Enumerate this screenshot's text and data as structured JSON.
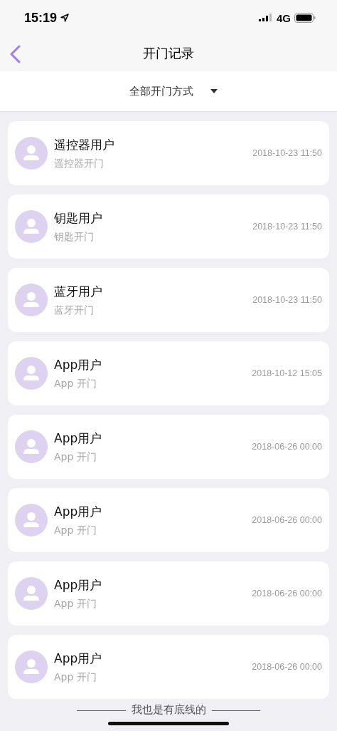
{
  "status_bar": {
    "time": "15:19",
    "network": "4G"
  },
  "nav": {
    "title": "开门记录"
  },
  "filter": {
    "label": "全部开门方式"
  },
  "records": [
    {
      "name": "遥控器用户",
      "method": "遥控器开门",
      "time": "2018-10-23 11:50"
    },
    {
      "name": "钥匙用户",
      "method": "钥匙开门",
      "time": "2018-10-23 11:50"
    },
    {
      "name": "蓝牙用户",
      "method": "蓝牙开门",
      "time": "2018-10-23 11:50"
    },
    {
      "name": "App用户",
      "method": "App 开门",
      "time": "2018-10-12 15:05"
    },
    {
      "name": "App用户",
      "method": "App 开门",
      "time": "2018-06-26 00:00"
    },
    {
      "name": "App用户",
      "method": "App 开门",
      "time": "2018-06-26 00:00"
    },
    {
      "name": "App用户",
      "method": "App 开门",
      "time": "2018-06-26 00:00"
    },
    {
      "name": "App用户",
      "method": "App 开门",
      "time": "2018-06-26 00:00"
    }
  ],
  "footer": {
    "text": "我也是有底线的"
  }
}
